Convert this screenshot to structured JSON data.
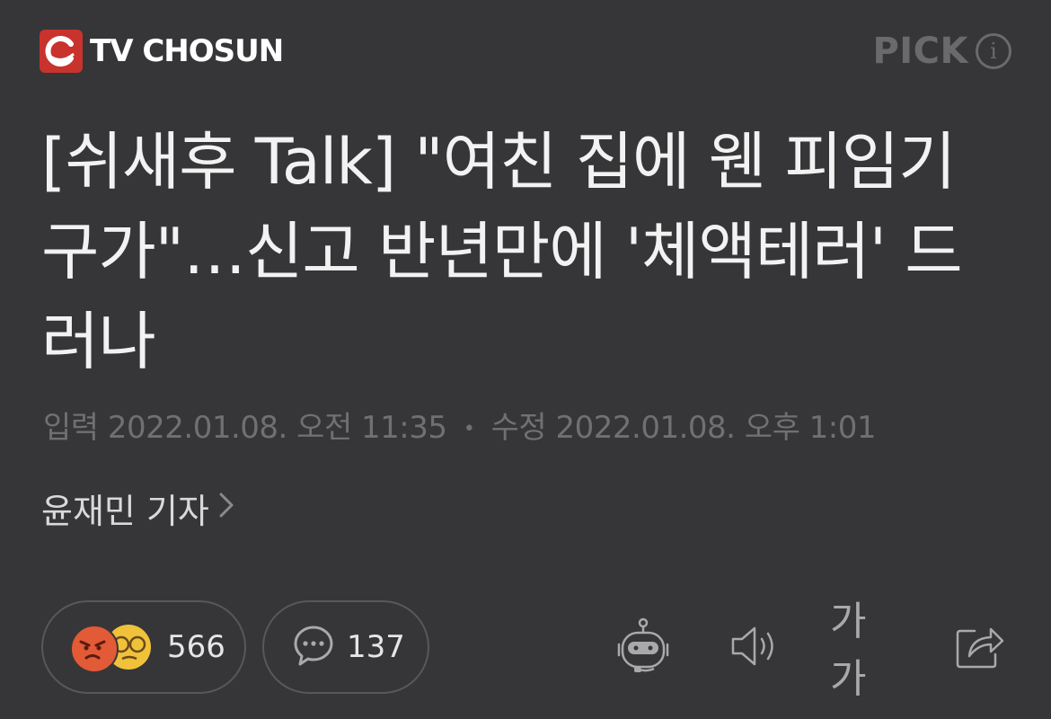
{
  "header": {
    "brand": "TV CHOSUN",
    "pick_label": "PICK"
  },
  "article": {
    "headline": "[쉬새후 Talk] \"여친 집에 웬 피임기구가\"…신고 반년만에 '체액테러' 드러나",
    "published_label": "입력",
    "published": "2022.01.08. 오전 11:35",
    "modified_label": "수정",
    "modified": "2022.01.08. 오후 1:01",
    "reporter": "윤재민 기자"
  },
  "toolbar": {
    "reaction_count": "566",
    "comment_count": "137",
    "font_label": "가가"
  },
  "icons": {
    "logo": "tv-chosun-logo-icon",
    "info": "info-icon",
    "chevron": "chevron-right-icon",
    "comment": "comment-icon",
    "robot": "robot-icon",
    "speaker": "speaker-icon",
    "share": "share-icon"
  }
}
